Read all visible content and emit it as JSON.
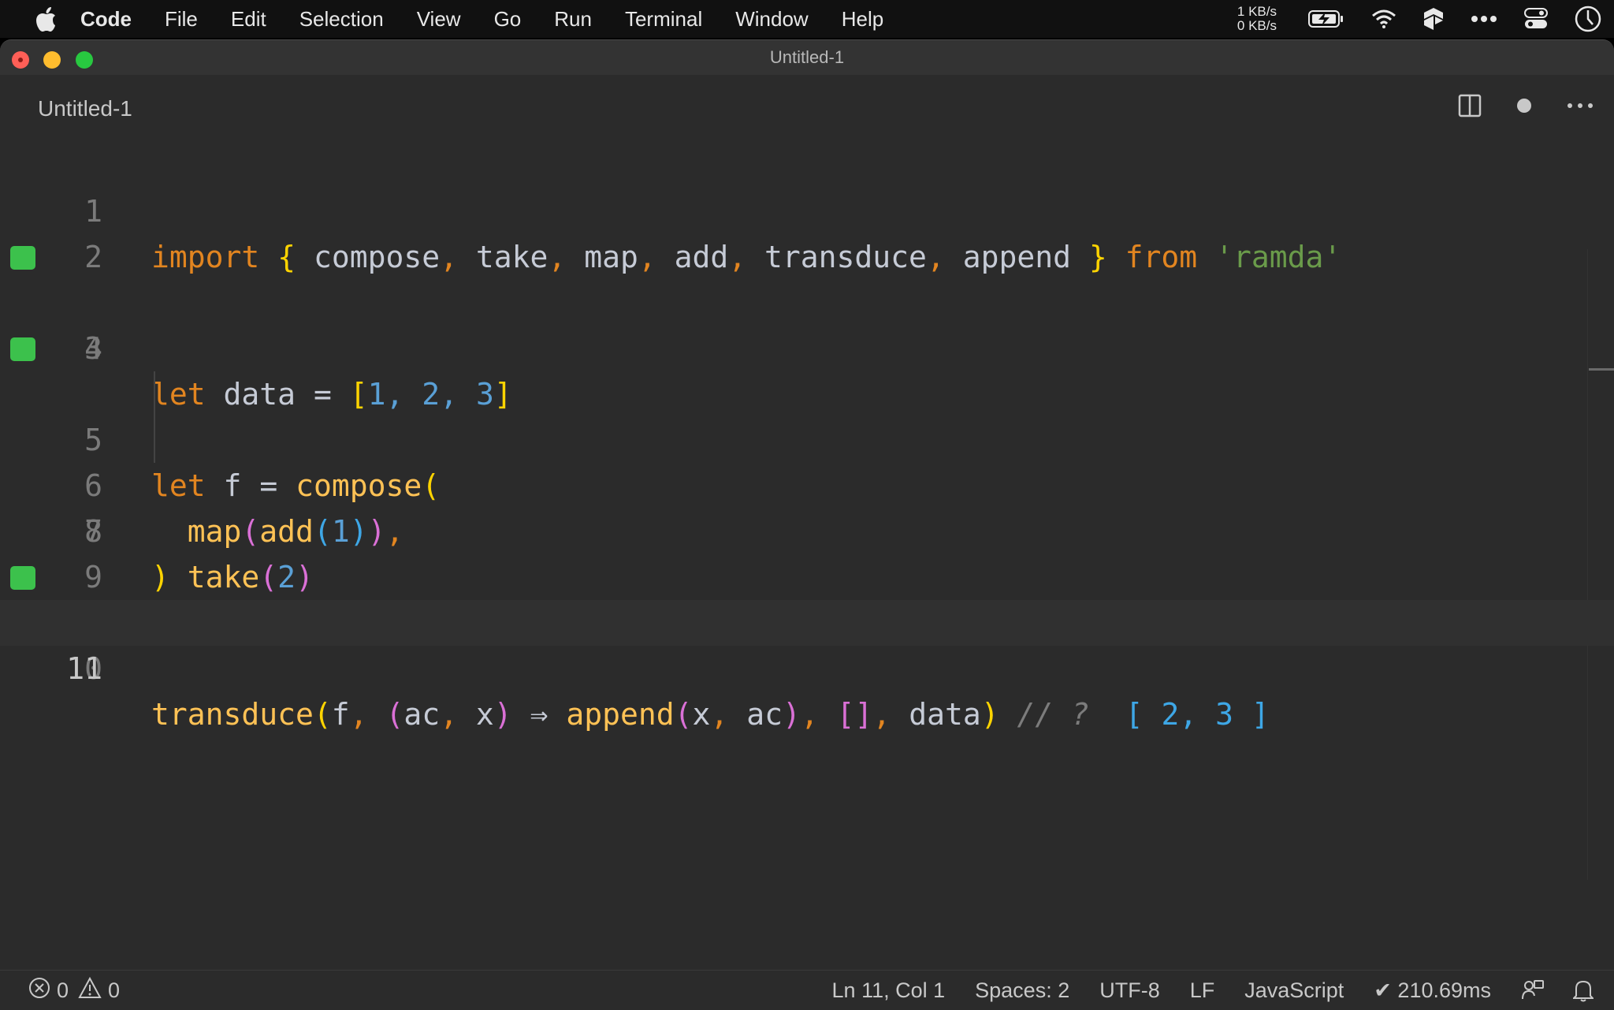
{
  "menubar": {
    "items": [
      "Code",
      "File",
      "Edit",
      "Selection",
      "View",
      "Go",
      "Run",
      "Terminal",
      "Window",
      "Help"
    ],
    "net_up": "1 KB/s",
    "net_down": "0 KB/s"
  },
  "window": {
    "title": "Untitled-1",
    "tab_label": "Untitled-1"
  },
  "editor": {
    "line_numbers": [
      "1",
      "2",
      "3",
      "4",
      "5",
      "6",
      "7",
      "8",
      "9",
      "10",
      "11"
    ],
    "current_line": 11,
    "code": {
      "l1": {
        "import": "import",
        "lb": "{",
        "compose": "compose",
        "take": "take",
        "map": "map",
        "add": "add",
        "transduce": "transduce",
        "append": "append",
        "rb": "}",
        "from": "from",
        "module": "'ramda'"
      },
      "l3": {
        "let": "let",
        "name": "data",
        "eq": "=",
        "lb": "[",
        "v1": "1",
        "v2": "2",
        "v3": "3",
        "rb": "]"
      },
      "l5": {
        "let": "let",
        "name": "f",
        "eq": "=",
        "fn": "compose",
        "lp": "("
      },
      "l6": {
        "map": "map",
        "add": "add",
        "arg": "1"
      },
      "l7": {
        "take": "take",
        "arg": "2"
      },
      "l8": {
        "rp": ")"
      },
      "l10": {
        "fn": "transduce",
        "f": "f",
        "ac": "ac",
        "x": "x",
        "arrow": "⇒",
        "append": "append",
        "data": "data",
        "comment": "// ?",
        "result": "[ 2, 3 ]"
      }
    }
  },
  "statusbar": {
    "errors": "0",
    "warnings": "0",
    "position": "Ln 11, Col 1",
    "spaces": "Spaces: 2",
    "encoding": "UTF-8",
    "eol": "LF",
    "language": "JavaScript",
    "timing": "✔ 210.69ms"
  },
  "colors": {
    "gutter_marker": "#3cc14c",
    "keyword": "#e28520",
    "function": "#ffc255",
    "string": "#6a9b4a"
  }
}
